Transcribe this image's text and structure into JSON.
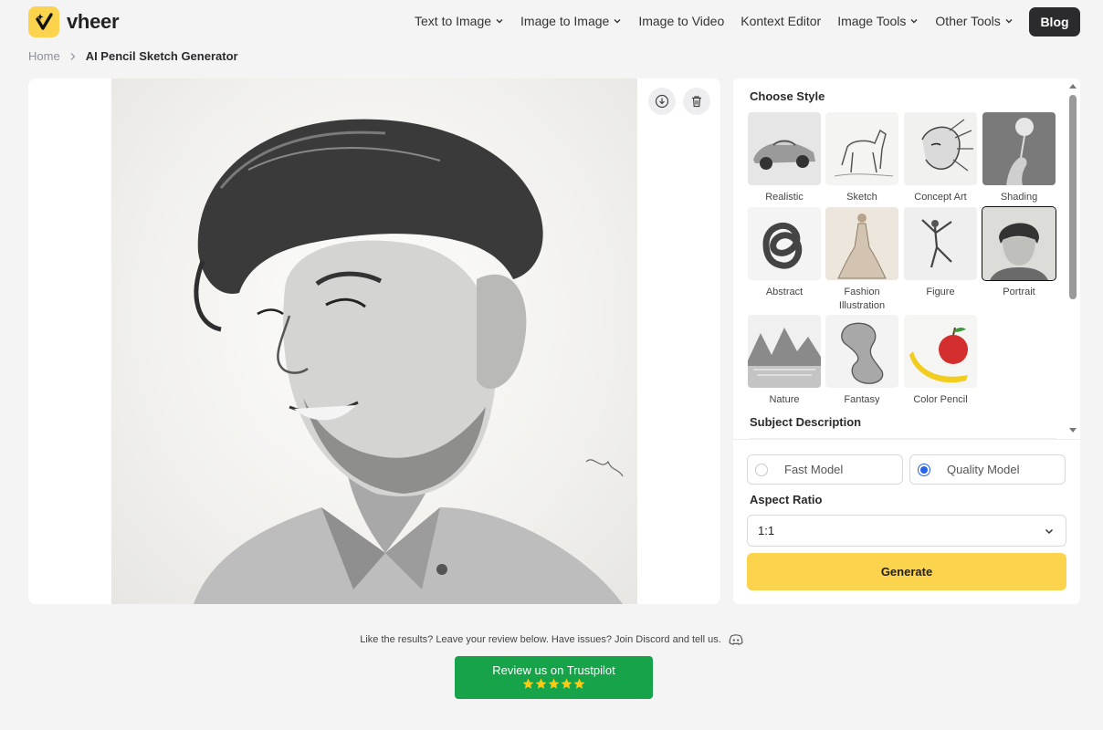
{
  "brand": {
    "name": "vheer",
    "accent": "#fcd34d"
  },
  "nav": {
    "items": [
      {
        "label": "Text to Image",
        "dropdown": true
      },
      {
        "label": "Image to Image",
        "dropdown": true
      },
      {
        "label": "Image to Video",
        "dropdown": false
      },
      {
        "label": "Kontext Editor",
        "dropdown": false
      },
      {
        "label": "Image Tools",
        "dropdown": true
      },
      {
        "label": "Other Tools",
        "dropdown": true
      }
    ],
    "blog_label": "Blog"
  },
  "breadcrumb": {
    "home": "Home",
    "current": "AI Pencil Sketch Generator"
  },
  "preview": {
    "actions": [
      {
        "icon": "download-icon"
      },
      {
        "icon": "trash-icon"
      }
    ]
  },
  "settings": {
    "style_title": "Choose Style",
    "styles": [
      {
        "label": "Realistic",
        "selected": false
      },
      {
        "label": "Sketch",
        "selected": false
      },
      {
        "label": "Concept Art",
        "selected": false
      },
      {
        "label": "Shading",
        "selected": false
      },
      {
        "label": "Abstract",
        "selected": false
      },
      {
        "label": "Fashion Illustration",
        "selected": false
      },
      {
        "label": "Figure",
        "selected": false
      },
      {
        "label": "Portrait",
        "selected": true
      },
      {
        "label": "Nature",
        "selected": false
      },
      {
        "label": "Fantasy",
        "selected": false
      },
      {
        "label": "Color Pencil",
        "selected": false
      }
    ],
    "subject_title": "Subject Description",
    "models": [
      {
        "label": "Fast Model",
        "checked": false
      },
      {
        "label": "Quality Model",
        "checked": true
      }
    ],
    "aspect_title": "Aspect Ratio",
    "aspect_value": "1:1",
    "generate_label": "Generate"
  },
  "footer": {
    "feedback_text": "Like the results? Leave your review below. Have issues? Join Discord and tell us.",
    "trustpilot_label": "Review us on Trustpilot",
    "rating_stars": 5
  },
  "colors": {
    "cta": "#fcd34d",
    "trustpilot": "#16a34a",
    "radio": "#2563eb",
    "dark": "#2b2b2d"
  }
}
